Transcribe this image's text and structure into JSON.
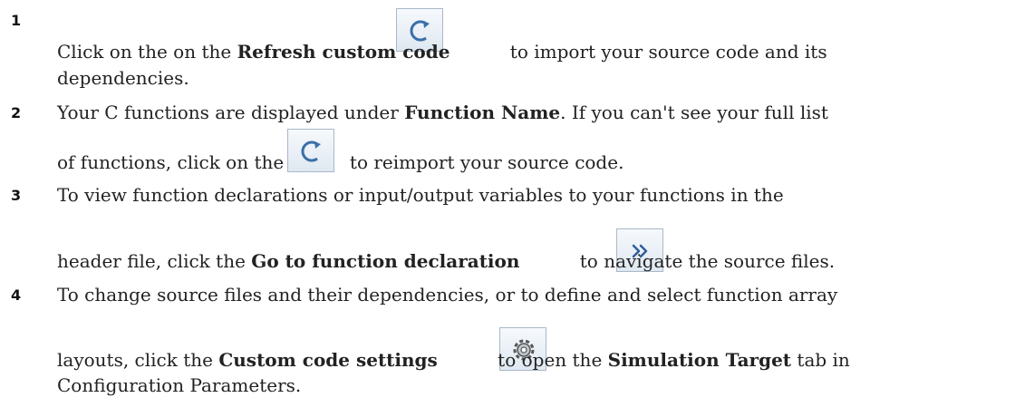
{
  "steps": [
    {
      "number": "1",
      "line1": {
        "pre": "Click on the on the ",
        "bold": "Refresh custom code",
        "post": " to import your source code and its"
      },
      "line2": "dependencies.",
      "icon": "refresh-icon"
    },
    {
      "number": "2",
      "line1": {
        "pre": "Your C functions are displayed under ",
        "bold": "Function Name",
        "post": ". If you can't see your full list"
      },
      "line2": {
        "pre": "of functions, click on the ",
        "post": " to reimport your source code."
      },
      "icon": "refresh-icon"
    },
    {
      "number": "3",
      "line1": "To view function declarations or input/output variables to your functions in the",
      "line2": {
        "pre": "header file, click the ",
        "bold": "Go to function declaration",
        "post": " to navigate the source files."
      },
      "icon": "double-chevron-right-icon"
    },
    {
      "number": "4",
      "line1": "To change source files and their dependencies, or to define and select function array",
      "line2": {
        "pre": "layouts, click the ",
        "bold": "Custom code settings",
        "mid": " to open the ",
        "bold2": "Simulation Target",
        "post": " tab in"
      },
      "line3": "Configuration Parameters.",
      "icon": "gear-icon"
    }
  ]
}
